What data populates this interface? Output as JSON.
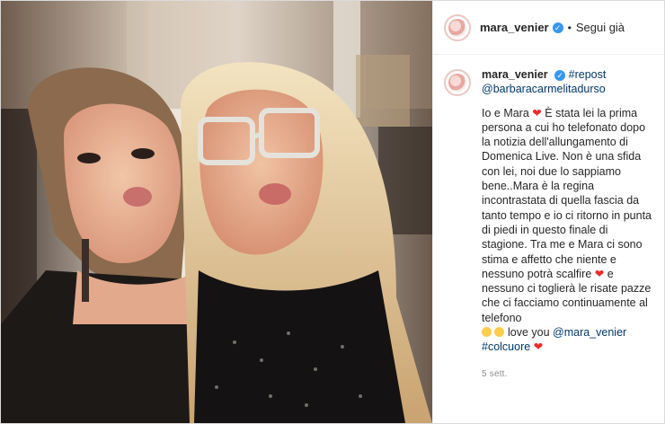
{
  "header": {
    "username": "mara_venier",
    "dot": "•",
    "follow_status": "Segui già"
  },
  "caption": {
    "username": "mara_venier",
    "hashtag_repost": "#repost",
    "mention_source": "@barbaracarmelitadurso",
    "text_1": "Io e Mara",
    "text_2": "È stata lei la prima persona a cui ho telefonato dopo la notizia dell'allungamento di Domenica Live. Non è una sfida con lei, noi due lo sappiamo bene..Mara è la regina incontrastata di quella fascia da tanto tempo e io ci ritorno in punta di piedi in questo finale di stagione. Tra me e Mara ci sono stima e affetto che niente e nessuno potrà scalfire",
    "text_3": "e nessuno ci toglierà le risate pazze che ci facciamo continuamente al telefono",
    "text_4": "love you",
    "mention_mara": "@mara_venier",
    "hashtag_colcuore": "#colcuore",
    "timestamp": "5 sett."
  },
  "colors": {
    "link": "#00376b",
    "verified": "#3897f0",
    "heart": "#ed2b2b",
    "muted": "#8e8e8e"
  }
}
